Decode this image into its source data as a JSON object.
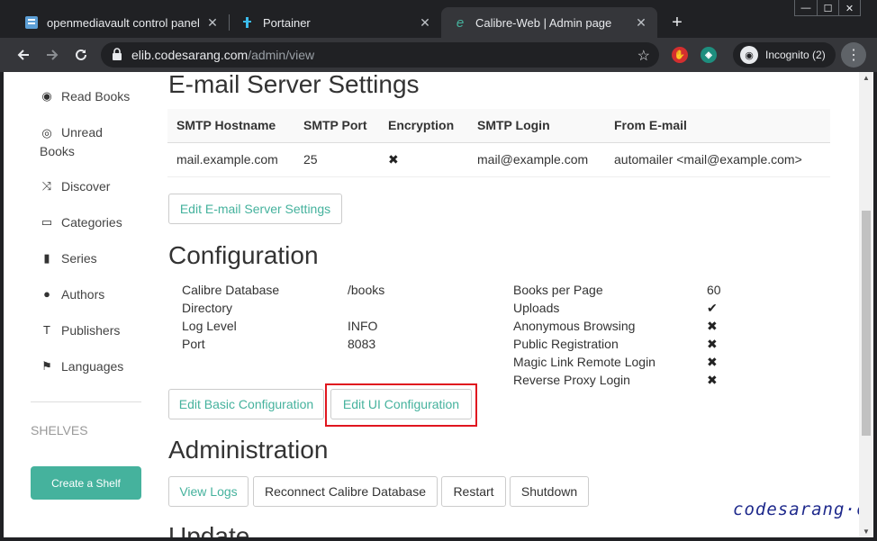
{
  "browser": {
    "tabs": [
      {
        "title": "openmediavault control panel - c",
        "close": "✕"
      },
      {
        "title": "Portainer",
        "close": "✕"
      },
      {
        "title": "Calibre-Web | Admin page",
        "close": "✕"
      }
    ],
    "new_tab": "+",
    "window_controls": [
      "—",
      "☐",
      "✕"
    ],
    "url_host": "elib.codesarang.com",
    "url_path": "/admin/view",
    "incognito_label": "Incognito (2)"
  },
  "sidebar": {
    "items": [
      {
        "label": "Read Books",
        "icon": "eye-icon"
      },
      {
        "label": "Unread Books",
        "icon": "eye-slash-icon"
      },
      {
        "label": "Discover",
        "icon": "shuffle-icon"
      },
      {
        "label": "Categories",
        "icon": "inbox-icon"
      },
      {
        "label": "Series",
        "icon": "bookmark-icon"
      },
      {
        "label": "Authors",
        "icon": "user-icon"
      },
      {
        "label": "Publishers",
        "icon": "text-size-icon"
      },
      {
        "label": "Languages",
        "icon": "flag-icon"
      }
    ],
    "shelves_heading": "SHELVES",
    "create_shelf_label": "Create a Shelf"
  },
  "email": {
    "heading": "E-mail Server Settings",
    "columns": [
      "SMTP Hostname",
      "SMTP Port",
      "Encryption",
      "SMTP Login",
      "From E-mail"
    ],
    "row": {
      "hostname": "mail.example.com",
      "port": "25",
      "encryption": "✖",
      "login": "mail@example.com",
      "from": "automailer <mail@example.com>"
    },
    "edit_button": "Edit E-mail Server Settings"
  },
  "configuration": {
    "heading": "Configuration",
    "left": [
      {
        "label": "Calibre Database Directory",
        "value": "/books"
      },
      {
        "label": "Log Level",
        "value": "INFO"
      },
      {
        "label": "Port",
        "value": "8083"
      }
    ],
    "right": [
      {
        "label": "Books per Page",
        "value": "60"
      },
      {
        "label": "Uploads",
        "value": "✔"
      },
      {
        "label": "Anonymous Browsing",
        "value": "✖"
      },
      {
        "label": "Public Registration",
        "value": "✖"
      },
      {
        "label": "Magic Link Remote Login",
        "value": "✖"
      },
      {
        "label": "Reverse Proxy Login",
        "value": "✖"
      }
    ],
    "edit_basic_button": "Edit Basic Configuration",
    "edit_ui_button": "Edit UI Configuration"
  },
  "administration": {
    "heading": "Administration",
    "buttons": [
      "View Logs",
      "Reconnect Calibre Database",
      "Restart",
      "Shutdown"
    ]
  },
  "update": {
    "heading": "Update"
  },
  "watermark": "codesarang·com",
  "colors": {
    "accent": "#45b29d",
    "highlight": "#e0161f",
    "chrome_dark": "#202124",
    "chrome_toolbar": "#35363a"
  }
}
